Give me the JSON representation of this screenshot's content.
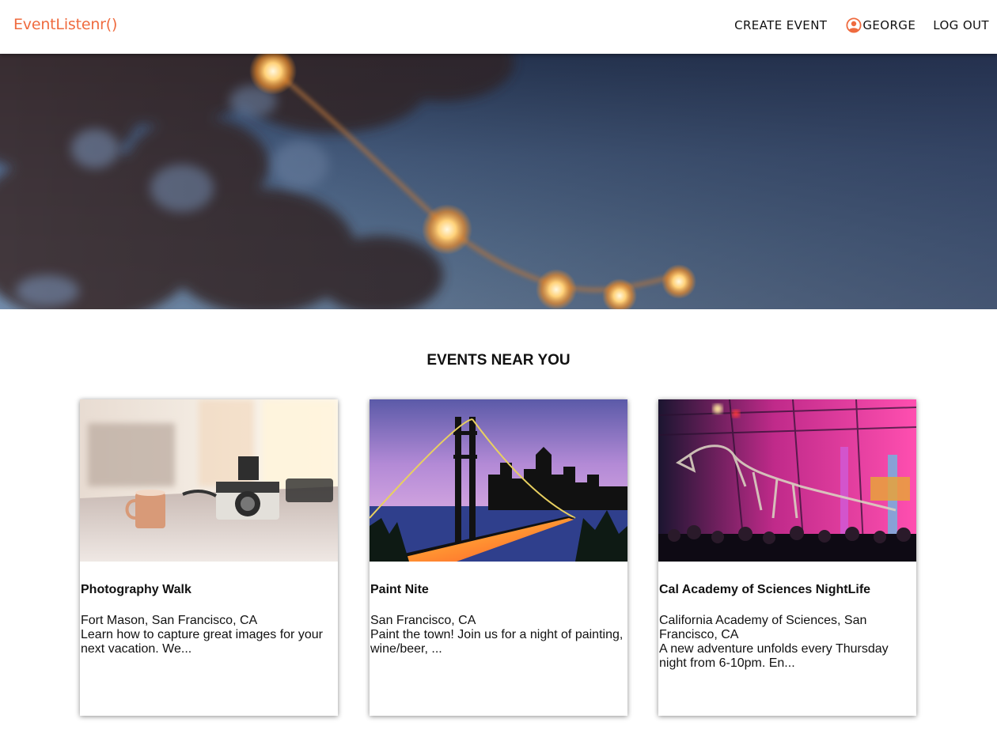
{
  "app": {
    "logo_text": "EventListenr()",
    "brand_color": "#ef6b3f"
  },
  "nav": {
    "create_event": "CREATE EVENT",
    "user_name": "GEORGE",
    "user_icon": "user-circle-icon",
    "log_out": "LOG OUT"
  },
  "hero": {
    "image": "string-lights-at-dusk"
  },
  "main": {
    "section_title": "EVENTS NEAR YOU",
    "events": [
      {
        "title": "Photography Walk",
        "location": "Fort Mason, San Francisco, CA",
        "description": "Learn how to capture great images for your next vacation. We...",
        "image": "camera-and-mug-on-table"
      },
      {
        "title": "Paint Nite",
        "location": "San Francisco, CA",
        "description": "Paint the town! Join us for a night of painting, wine/beer, ...",
        "image": "bay-bridge-painting"
      },
      {
        "title": "Cal Academy of Sciences NightLife",
        "location": "California Academy of Sciences, San Francisco, CA",
        "description": "A new adventure unfolds every Thursday night from 6-10pm. En...",
        "image": "t-rex-skeleton-exhibit"
      }
    ]
  }
}
